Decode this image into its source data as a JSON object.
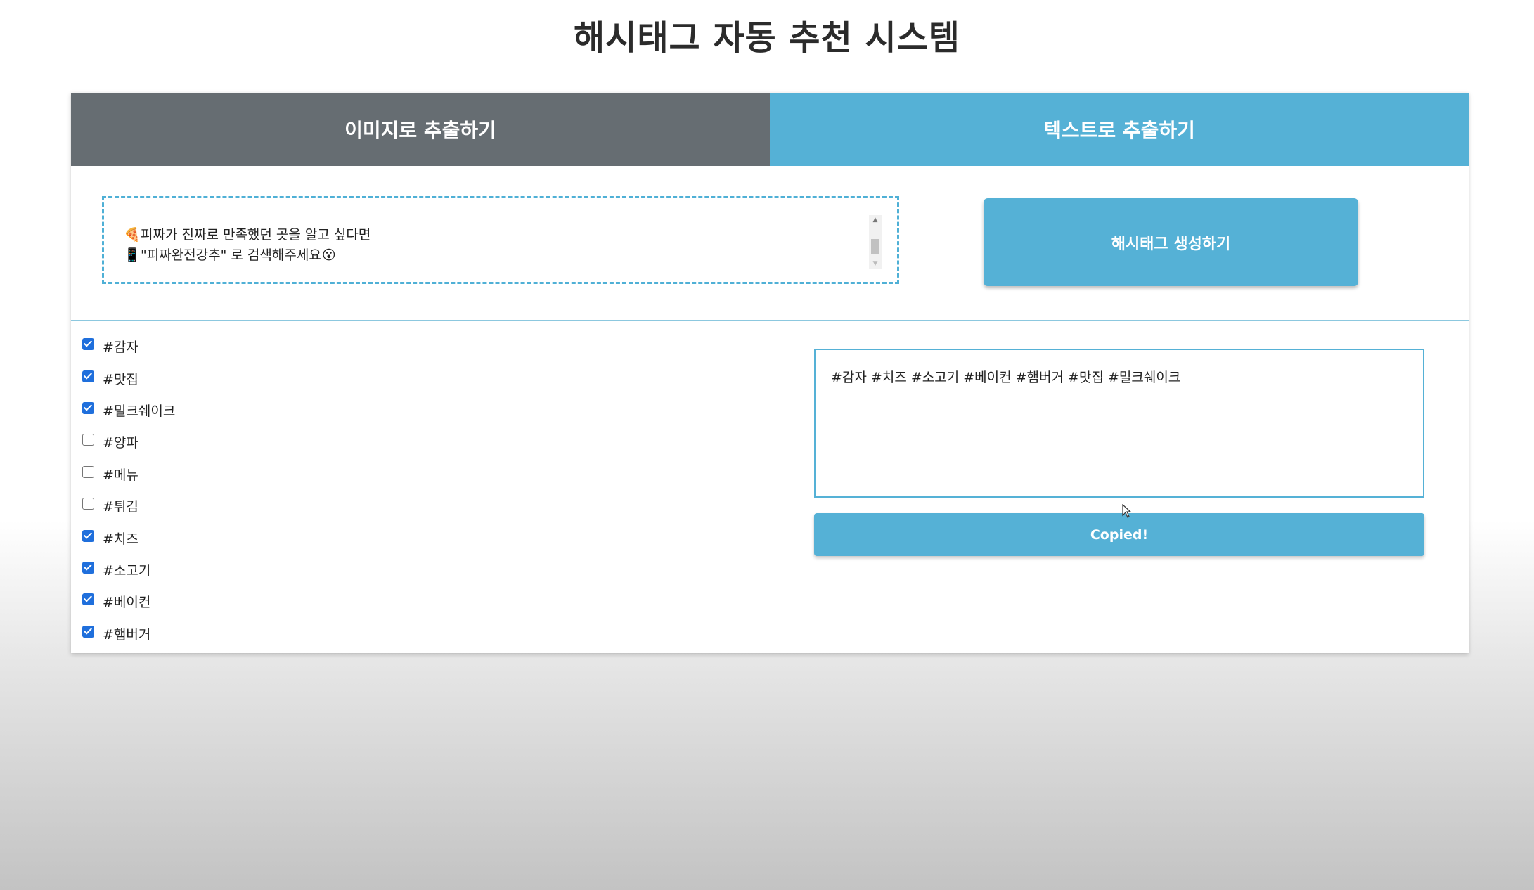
{
  "page": {
    "title": "해시태그 자동 추천 시스템"
  },
  "tabs": [
    {
      "label": "이미지로 추출하기"
    },
    {
      "label": "텍스트로 추출하기"
    }
  ],
  "input": {
    "lines": [
      {
        "icon": "pizza-icon",
        "glyph": "🍕",
        "text": "피짜가 진짜로 만족했던 곳을 알고 싶다면"
      },
      {
        "icon": "phone-icon",
        "glyph": "📱",
        "text": "\"피짜완전강추\" 로 검색해주세요",
        "suffix_glyph": "😮"
      }
    ]
  },
  "generate_button": {
    "label": "해시태그 생성하기"
  },
  "tags": [
    {
      "label": "#감자",
      "checked": true
    },
    {
      "label": "#맛집",
      "checked": true
    },
    {
      "label": "#밀크쉐이크",
      "checked": true
    },
    {
      "label": "#양파",
      "checked": false
    },
    {
      "label": "#메뉴",
      "checked": false
    },
    {
      "label": "#튀김",
      "checked": false
    },
    {
      "label": "#치즈",
      "checked": true
    },
    {
      "label": "#소고기",
      "checked": true
    },
    {
      "label": "#베이컨",
      "checked": true
    },
    {
      "label": "#햄버거",
      "checked": true
    }
  ],
  "result": {
    "text": "#감자 #치즈 #소고기 #베이컨 #햄버거 #맛집 #밀크쉐이크"
  },
  "copy_button": {
    "label": "Copied!"
  },
  "colors": {
    "accent": "#55b1d6",
    "inactive_tab": "#666d72",
    "checkbox": "#1f6fdc"
  }
}
